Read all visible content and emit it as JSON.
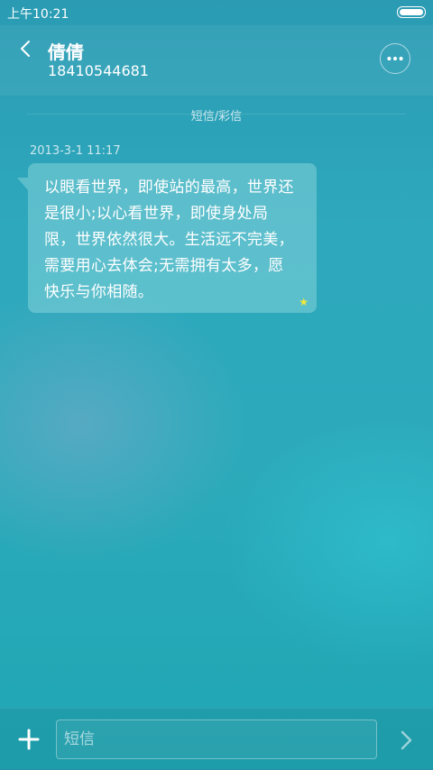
{
  "status": {
    "time": "上午10:21"
  },
  "header": {
    "name": "倩倩",
    "number": "18410544681"
  },
  "thread": {
    "type_label": "短信/彩信",
    "messages": [
      {
        "time": "2013-3-1 11:17",
        "text": "以眼看世界，即使站的最高，世界还是很小;以心看世界，即使身处局限，世界依然很大。生活远不完美，需要用心去体会;无需拥有太多，愿快乐与你相随。",
        "starred": true
      }
    ]
  },
  "composer": {
    "placeholder": "短信"
  },
  "colors": {
    "star": "#f3e83a"
  }
}
